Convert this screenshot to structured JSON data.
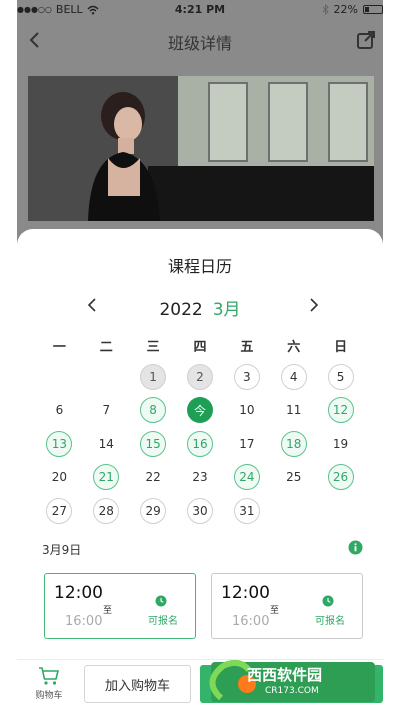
{
  "status_bar": {
    "carrier": "BELL",
    "time": "4:21 PM",
    "battery": "22%"
  },
  "nav": {
    "title": "班级详情"
  },
  "sheet": {
    "title": "课程日历",
    "year": "2022",
    "month": "3月"
  },
  "weekdays": [
    "一",
    "二",
    "三",
    "四",
    "五",
    "六",
    "日"
  ],
  "calendar": {
    "leading_blanks": 2,
    "days": [
      {
        "label": "1",
        "state": "past"
      },
      {
        "label": "2",
        "state": "past"
      },
      {
        "label": "3",
        "state": "outlined"
      },
      {
        "label": "4",
        "state": "outlined"
      },
      {
        "label": "5",
        "state": "outlined"
      },
      {
        "label": "6",
        "state": "plain"
      },
      {
        "label": "7",
        "state": "plain"
      },
      {
        "label": "8",
        "state": "course"
      },
      {
        "label": "今",
        "state": "today"
      },
      {
        "label": "10",
        "state": "plain"
      },
      {
        "label": "11",
        "state": "plain"
      },
      {
        "label": "12",
        "state": "course"
      },
      {
        "label": "13",
        "state": "course"
      },
      {
        "label": "14",
        "state": "plain"
      },
      {
        "label": "15",
        "state": "course"
      },
      {
        "label": "16",
        "state": "course"
      },
      {
        "label": "17",
        "state": "plain"
      },
      {
        "label": "18",
        "state": "course"
      },
      {
        "label": "19",
        "state": "plain"
      },
      {
        "label": "20",
        "state": "plain"
      },
      {
        "label": "21",
        "state": "course"
      },
      {
        "label": "22",
        "state": "plain"
      },
      {
        "label": "23",
        "state": "plain"
      },
      {
        "label": "24",
        "state": "course"
      },
      {
        "label": "25",
        "state": "plain"
      },
      {
        "label": "26",
        "state": "course"
      },
      {
        "label": "27",
        "state": "outlined"
      },
      {
        "label": "28",
        "state": "outlined"
      },
      {
        "label": "29",
        "state": "outlined"
      },
      {
        "label": "30",
        "state": "outlined"
      },
      {
        "label": "31",
        "state": "outlined"
      }
    ]
  },
  "selected_date": "3月9日",
  "slots": [
    {
      "start": "12:00",
      "sep": "至",
      "end": "16:00",
      "status": "可报名",
      "active": true
    },
    {
      "start": "12:00",
      "sep": "至",
      "end": "16:00",
      "status": "可报名",
      "active": false
    }
  ],
  "bottom_bar": {
    "cart_label": "购物车",
    "add_cart_label": "加入购物车"
  },
  "watermark": {
    "main": "西西软件园",
    "sub": "CR173.COM"
  },
  "colors": {
    "accent": "#2fa866",
    "today": "#1f9e56",
    "button": "#33b46a"
  },
  "icons": [
    "wifi-icon",
    "bluetooth-icon",
    "battery-icon",
    "back-arrow-icon",
    "share-icon",
    "chevron-left-icon",
    "chevron-right-icon",
    "info-icon",
    "clock-icon",
    "cart-icon"
  ]
}
